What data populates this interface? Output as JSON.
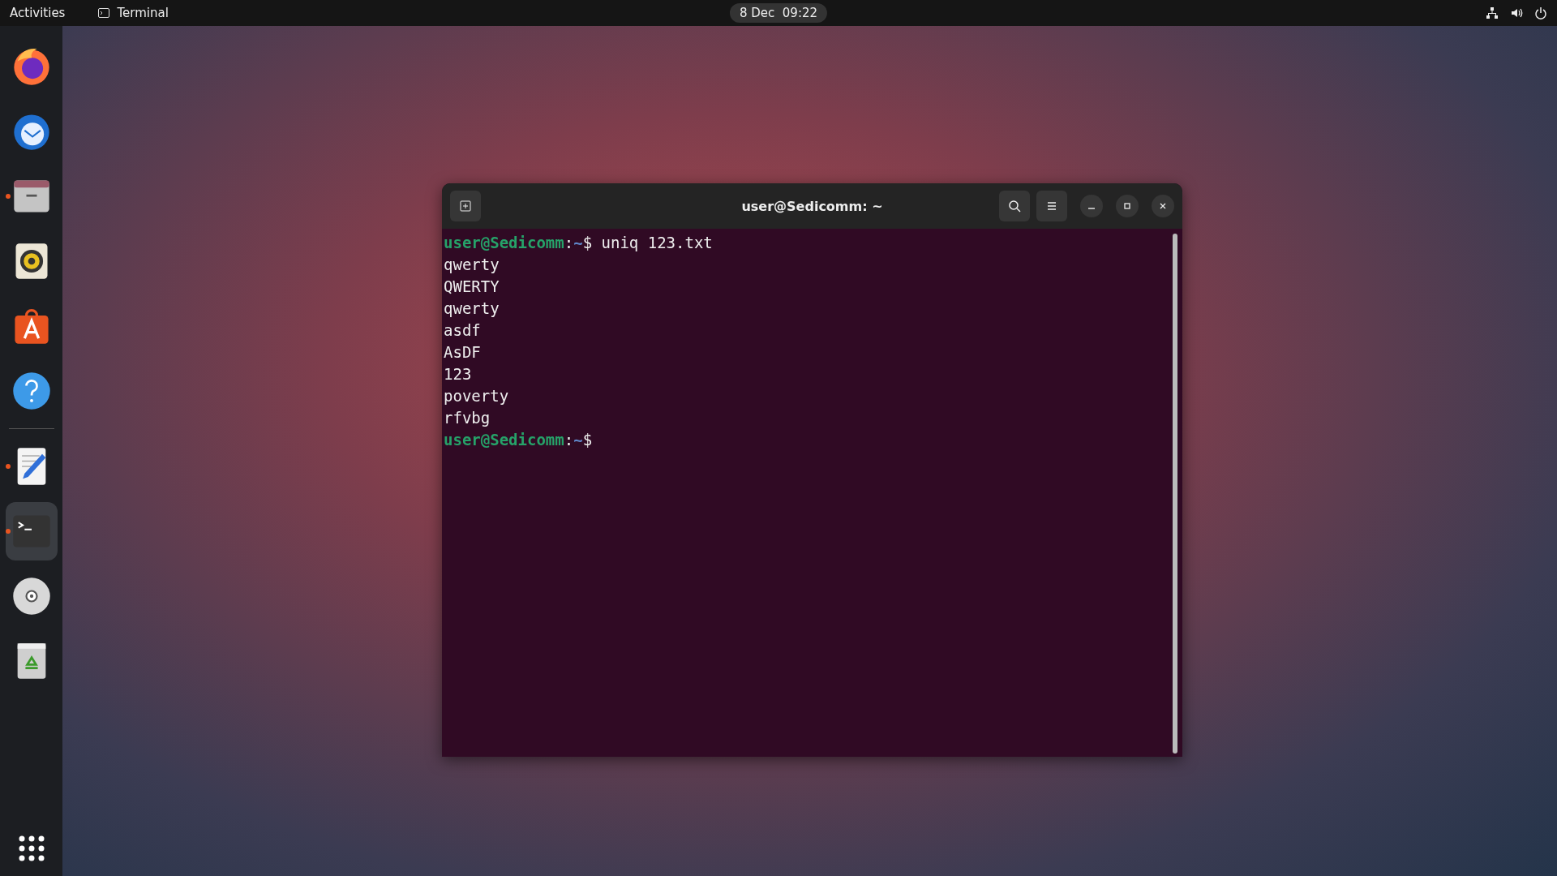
{
  "top_bar": {
    "activities": "Activities",
    "app_name": "Terminal",
    "clock": "8 Dec  09:22"
  },
  "dock": {
    "favorites": [
      {
        "kind": "browser",
        "running": false,
        "selected": false
      },
      {
        "kind": "mail",
        "running": false,
        "selected": false
      },
      {
        "kind": "files",
        "running": true,
        "selected": false
      },
      {
        "kind": "music",
        "running": false,
        "selected": false
      },
      {
        "kind": "store",
        "running": false,
        "selected": false
      },
      {
        "kind": "help",
        "running": false,
        "selected": false
      }
    ],
    "others": [
      {
        "kind": "editor",
        "running": true,
        "selected": false
      },
      {
        "kind": "terminal",
        "running": true,
        "selected": true
      },
      {
        "kind": "disc",
        "running": false,
        "selected": false
      },
      {
        "kind": "trash",
        "running": false,
        "selected": false
      }
    ]
  },
  "terminal": {
    "title": "user@Sedicomm: ~",
    "lines": [
      {
        "kind": "prompt",
        "user_host": "user@Sedicomm",
        "separator": ":",
        "path": "~",
        "symbol": "$",
        "command": "uniq 123.txt"
      },
      {
        "kind": "output",
        "text": "qwerty"
      },
      {
        "kind": "output",
        "text": "QWERTY"
      },
      {
        "kind": "output",
        "text": "qwerty"
      },
      {
        "kind": "output",
        "text": "asdf"
      },
      {
        "kind": "output",
        "text": "AsDF"
      },
      {
        "kind": "output",
        "text": "123"
      },
      {
        "kind": "output",
        "text": "poverty"
      },
      {
        "kind": "output",
        "text": "rfvbg"
      },
      {
        "kind": "prompt",
        "user_host": "user@Sedicomm",
        "separator": ":",
        "path": "~",
        "symbol": "$"
      }
    ]
  }
}
